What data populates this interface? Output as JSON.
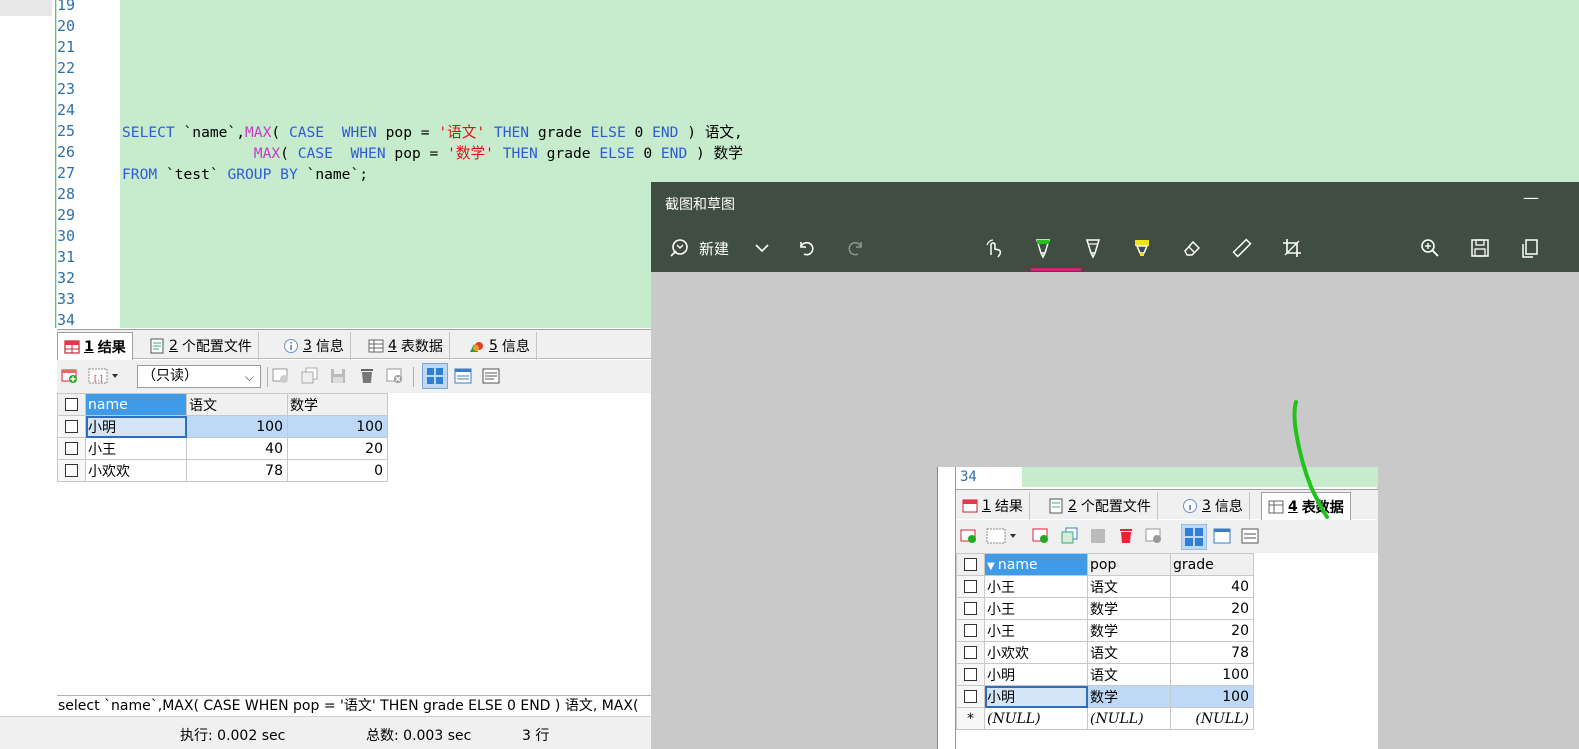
{
  "editor": {
    "line_numbers": [
      "19",
      "20",
      "21",
      "22",
      "23",
      "24",
      "25",
      "26",
      "27",
      "28",
      "29",
      "30",
      "31",
      "32",
      "33",
      "34"
    ],
    "line25": [
      {
        "t": "SELECT",
        "c": "kw"
      },
      {
        "t": " `name`,",
        "c": ""
      },
      {
        "t": "MAX",
        "c": "fn"
      },
      {
        "t": "( ",
        "c": ""
      },
      {
        "t": "CASE",
        "c": "kw"
      },
      {
        "t": "  ",
        "c": ""
      },
      {
        "t": "WHEN",
        "c": "kw"
      },
      {
        "t": " pop = ",
        "c": ""
      },
      {
        "t": "'语文'",
        "c": "str"
      },
      {
        "t": " ",
        "c": ""
      },
      {
        "t": "THEN",
        "c": "kw"
      },
      {
        "t": " grade ",
        "c": ""
      },
      {
        "t": "ELSE",
        "c": "kw"
      },
      {
        "t": " 0 ",
        "c": ""
      },
      {
        "t": "END",
        "c": "kw"
      },
      {
        "t": " ) 语文,",
        "c": ""
      }
    ],
    "line26": [
      {
        "t": "               ",
        "c": ""
      },
      {
        "t": "MAX",
        "c": "fn"
      },
      {
        "t": "( ",
        "c": ""
      },
      {
        "t": "CASE",
        "c": "kw"
      },
      {
        "t": "  ",
        "c": ""
      },
      {
        "t": "WHEN",
        "c": "kw"
      },
      {
        "t": " pop = ",
        "c": ""
      },
      {
        "t": "'数学'",
        "c": "str"
      },
      {
        "t": " ",
        "c": ""
      },
      {
        "t": "THEN",
        "c": "kw"
      },
      {
        "t": " grade ",
        "c": ""
      },
      {
        "t": "ELSE",
        "c": "kw"
      },
      {
        "t": " 0 ",
        "c": ""
      },
      {
        "t": "END",
        "c": "kw"
      },
      {
        "t": " ) 数学",
        "c": ""
      }
    ],
    "line27": [
      {
        "t": "FROM",
        "c": "kw"
      },
      {
        "t": " `test` ",
        "c": ""
      },
      {
        "t": "GROUP BY",
        "c": "kw"
      },
      {
        "t": " `name`;",
        "c": ""
      }
    ]
  },
  "result_tabs": [
    {
      "num": "1",
      "label": "结果",
      "active": true,
      "icon": "result-grid-icon"
    },
    {
      "num": "2",
      "label": "个配置文件",
      "active": false,
      "icon": "profile-icon"
    },
    {
      "num": "3",
      "label": "信息",
      "active": false,
      "icon": "info-icon"
    },
    {
      "num": "4",
      "label": "表数据",
      "active": false,
      "icon": "table-data-icon"
    },
    {
      "num": "5",
      "label": "信息",
      "active": false,
      "icon": "chart-info-icon"
    }
  ],
  "toolbar": {
    "readonly_select": "（只读）"
  },
  "result_table": {
    "columns": [
      "name",
      "语文",
      "数学"
    ],
    "rows": [
      [
        "小明",
        "100",
        "100"
      ],
      [
        "小王",
        "40",
        "20"
      ],
      [
        "小欢欢",
        "78",
        "0"
      ]
    ]
  },
  "sql_status": "select `name`,MAX( CASE WHEN pop = '语文' THEN grade ELSE 0 END ) 语文, MAX(",
  "status_bar": {
    "exec": "执行: 0.002 sec",
    "total": "总数: 0.003 sec",
    "rows": "3 行"
  },
  "snip": {
    "title": "截图和草图",
    "minimize": "—",
    "new_label": "新建",
    "image": {
      "line_number": "34",
      "tabs": [
        {
          "num": "1",
          "label": "结果",
          "active": false
        },
        {
          "num": "2",
          "label": "个配置文件",
          "active": false
        },
        {
          "num": "3",
          "label": "信息",
          "active": false
        },
        {
          "num": "4",
          "label": "表数据",
          "active": true
        }
      ],
      "columns": [
        "name",
        "pop",
        "grade"
      ],
      "rows": [
        [
          "小王",
          "语文",
          "40"
        ],
        [
          "小王",
          "数学",
          "20"
        ],
        [
          "小王",
          "数学",
          "20"
        ],
        [
          "小欢欢",
          "语文",
          "78"
        ],
        [
          "小明",
          "语文",
          "100"
        ],
        [
          "小明",
          "数学",
          "100"
        ]
      ],
      "new_row_marker": "*",
      "null_text": "(NULL)"
    }
  },
  "colors": {
    "editor_bg": "#c6ebcd",
    "keyword": "#2f5bd6",
    "function": "#c43bc4",
    "string": "#e01010",
    "snip_chrome": "#3f4e40",
    "pen_accent": "#d1237c",
    "ink_green": "#21c21b"
  }
}
